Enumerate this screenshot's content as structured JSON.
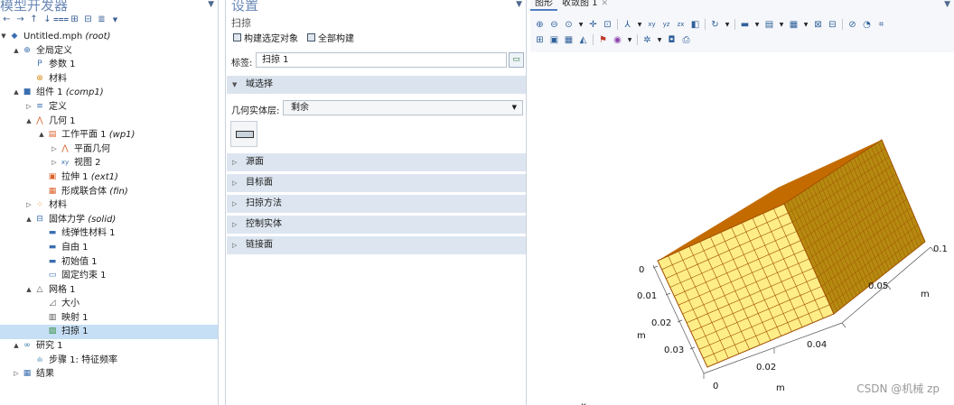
{
  "model_builder": {
    "title": "模型开发器",
    "tree": [
      {
        "level": 0,
        "exp": "▼",
        "icon": "◆",
        "icon_name": "model-icon",
        "icon_color": "#3b6fb0",
        "label": "Untitled.mph",
        "suffix": "(root)"
      },
      {
        "level": 1,
        "exp": "▲",
        "icon": "⊕",
        "icon_name": "globe-icon",
        "icon_color": "#3b6fb0",
        "label": "全局定义",
        "suffix": ""
      },
      {
        "level": 2,
        "exp": "",
        "icon": "P",
        "icon_name": "parameters-icon",
        "icon_color": "#3b6fb0",
        "label": "参数 1",
        "suffix": ""
      },
      {
        "level": 2,
        "exp": "",
        "icon": "⊗",
        "icon_name": "materials-icon",
        "icon_color": "#d98a1a",
        "label": "材料",
        "suffix": ""
      },
      {
        "level": 1,
        "exp": "▲",
        "icon": "■",
        "icon_name": "component-icon",
        "icon_color": "#3b6fb0",
        "label": "组件 1",
        "suffix": "(comp1)"
      },
      {
        "level": 2,
        "exp": "▷",
        "icon": "≡",
        "icon_name": "definitions-icon",
        "icon_color": "#3b6fb0",
        "label": "定义",
        "suffix": ""
      },
      {
        "level": 2,
        "exp": "▲",
        "icon": "⋀",
        "icon_name": "geometry-icon",
        "icon_color": "#d9612a",
        "label": "几何 1",
        "suffix": ""
      },
      {
        "level": 3,
        "exp": "▲",
        "icon": "▤",
        "icon_name": "work-plane-icon",
        "icon_color": "#d9612a",
        "label": "工作平面 1",
        "suffix": "(wp1)"
      },
      {
        "level": 4,
        "exp": "▷",
        "icon": "⋀",
        "icon_name": "plane-geometry-icon",
        "icon_color": "#d9612a",
        "label": "平面几何",
        "suffix": ""
      },
      {
        "level": 4,
        "exp": "▷",
        "icon": "xy",
        "icon_name": "view-icon",
        "icon_color": "#3b6fb0",
        "label": "视图 2",
        "suffix": ""
      },
      {
        "level": 3,
        "exp": "",
        "icon": "▣",
        "icon_name": "extrude-icon",
        "icon_color": "#d9612a",
        "label": "拉伸 1",
        "suffix": "(ext1)"
      },
      {
        "level": 3,
        "exp": "",
        "icon": "▦",
        "icon_name": "form-union-icon",
        "icon_color": "#d9612a",
        "label": "形成联合体",
        "suffix": "(fin)"
      },
      {
        "level": 2,
        "exp": "▷",
        "icon": "⁘",
        "icon_name": "materials-icon",
        "icon_color": "#d98a1a",
        "label": "材料",
        "suffix": ""
      },
      {
        "level": 2,
        "exp": "▲",
        "icon": "⊟",
        "icon_name": "solid-mechanics-icon",
        "icon_color": "#3b6fb0",
        "label": "固体力学",
        "suffix": "(solid)"
      },
      {
        "level": 3,
        "exp": "",
        "icon": "▬",
        "icon_name": "linear-elastic-icon",
        "icon_color": "#3b6fb0",
        "label": "线弹性材料 1",
        "suffix": ""
      },
      {
        "level": 3,
        "exp": "",
        "icon": "▬",
        "icon_name": "free-icon",
        "icon_color": "#3b6fb0",
        "label": "自由 1",
        "suffix": ""
      },
      {
        "level": 3,
        "exp": "",
        "icon": "▬",
        "icon_name": "initial-values-icon",
        "icon_color": "#3b6fb0",
        "label": "初始值 1",
        "suffix": ""
      },
      {
        "level": 3,
        "exp": "",
        "icon": "▭",
        "icon_name": "fixed-constraint-icon",
        "icon_color": "#3b6fb0",
        "label": "固定约束 1",
        "suffix": ""
      },
      {
        "level": 2,
        "exp": "▲",
        "icon": "△",
        "icon_name": "mesh-icon",
        "icon_color": "#555555",
        "label": "网格 1",
        "suffix": ""
      },
      {
        "level": 3,
        "exp": "",
        "icon": "◿",
        "icon_name": "size-icon",
        "icon_color": "#555555",
        "label": "大小",
        "suffix": ""
      },
      {
        "level": 3,
        "exp": "",
        "icon": "▥",
        "icon_name": "mapped-icon",
        "icon_color": "#555555",
        "label": "映射 1",
        "suffix": ""
      },
      {
        "level": 3,
        "exp": "",
        "icon": "▨",
        "icon_name": "swept-icon",
        "icon_color": "#2f8a3a",
        "label": "扫掠 1",
        "suffix": "",
        "selected": true
      },
      {
        "level": 1,
        "exp": "▲",
        "icon": "∞",
        "icon_name": "study-icon",
        "icon_color": "#2f7aa8",
        "label": "研究 1",
        "suffix": ""
      },
      {
        "level": 2,
        "exp": "",
        "icon": "ılı",
        "icon_name": "step-icon",
        "icon_color": "#2f7aa8",
        "label": "步骤 1: 特征频率",
        "suffix": ""
      },
      {
        "level": 1,
        "exp": "▷",
        "icon": "▦",
        "icon_name": "results-icon",
        "icon_color": "#3b6fb0",
        "label": "结果",
        "suffix": ""
      }
    ]
  },
  "settings": {
    "title": "设置",
    "subtitle": "扫掠",
    "build_selected": "构建选定对象",
    "build_all": "全部构建",
    "label_key": "标签:",
    "label_value": "扫掠 1",
    "domain_selection": "域选择",
    "geom_level_key": "几何实体层:",
    "geom_level_value": "剩余",
    "sections": [
      "源面",
      "目标面",
      "扫掠方法",
      "控制实体",
      "链接面"
    ]
  },
  "graphics": {
    "tabs": [
      "图形",
      "收敛图 1"
    ],
    "axis_labels": {
      "front_z_ticks": [
        "0",
        "0.01",
        "0.02",
        "0.03"
      ],
      "front_unit": "m",
      "bottom_ticks": [
        "0",
        "0.02"
      ],
      "bottom_unit": "m",
      "right_ticks": [
        "0.04",
        "0.05",
        "0.1"
      ],
      "right_unit": "m",
      "corner_axis": "x"
    },
    "watermark": "CSDN @机械 zp",
    "colors": {
      "front_face": "#ffee88",
      "top_face": "#c46b00",
      "side_face": "#b58a10",
      "mesh_lines": "#a05000"
    }
  }
}
